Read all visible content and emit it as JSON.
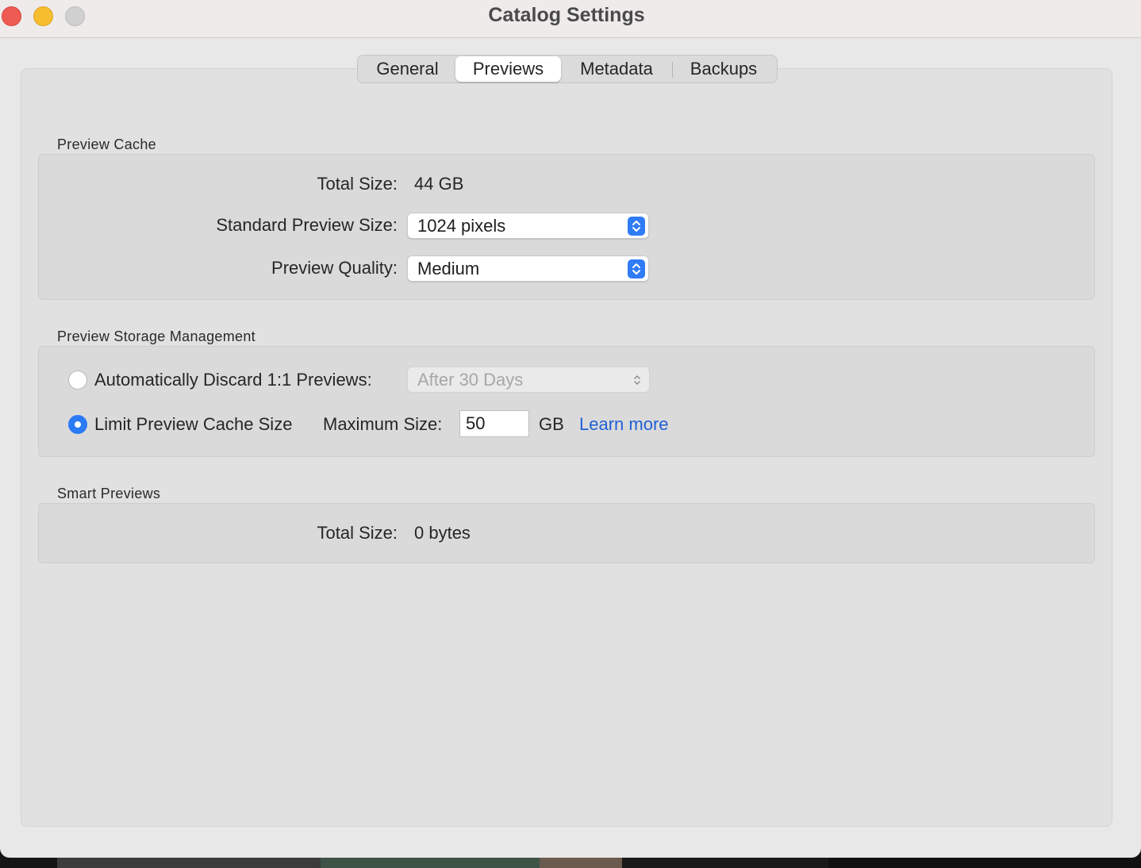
{
  "window": {
    "title": "Catalog Settings"
  },
  "tabs": [
    {
      "label": "General",
      "active": false
    },
    {
      "label": "Previews",
      "active": true
    },
    {
      "label": "Metadata",
      "active": false
    },
    {
      "label": "Backups",
      "active": false
    }
  ],
  "preview_cache": {
    "section_title": "Preview Cache",
    "total_size_label": "Total Size:",
    "total_size_value": "44 GB",
    "standard_preview_size_label": "Standard Preview Size:",
    "standard_preview_size_value": "1024 pixels",
    "preview_quality_label": "Preview Quality:",
    "preview_quality_value": "Medium"
  },
  "storage_management": {
    "section_title": "Preview Storage Management",
    "auto_discard_label": "Automatically Discard 1:1 Previews:",
    "auto_discard_value": "After 30 Days",
    "auto_discard_selected": false,
    "limit_cache_label": "Limit Preview Cache Size",
    "limit_cache_selected": true,
    "max_size_label": "Maximum Size:",
    "max_size_value": "50",
    "max_size_unit": "GB",
    "learn_more": "Learn more"
  },
  "smart_previews": {
    "section_title": "Smart Previews",
    "total_size_label": "Total Size:",
    "total_size_value": "0 bytes"
  },
  "colors": {
    "accent": "#2a7bf5",
    "link": "#1f5fd6",
    "close": "#ee5b53",
    "minimize": "#f6bd2f",
    "maximize": "#d1d0d0"
  }
}
